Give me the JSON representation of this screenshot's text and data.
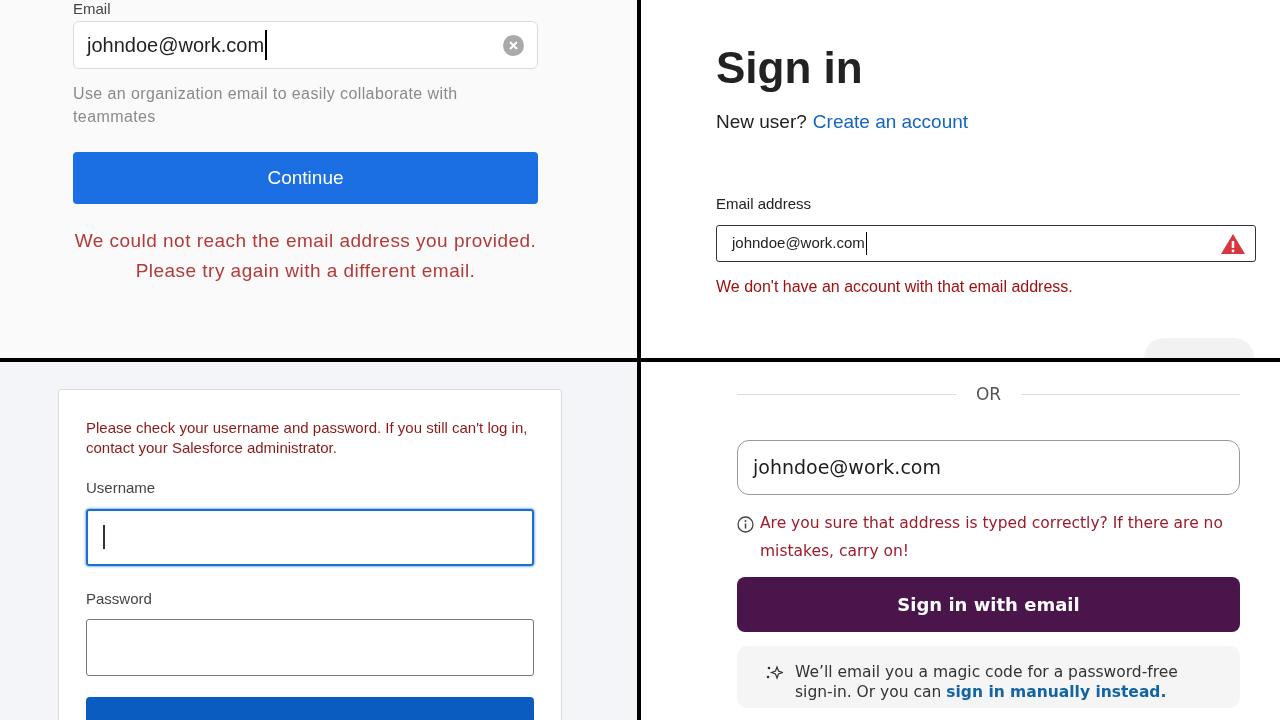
{
  "panels": [
    {
      "kind": "org_email",
      "label": "Email",
      "value": "johndoe@work.com",
      "hint": "Use an organization email to easily collaborate with teammates",
      "button": "Continue",
      "error": "We could not reach the email address you provided. Please try again with a different email."
    },
    {
      "kind": "sign_in",
      "title": "Sign in",
      "prompt": "New user?",
      "link": "Create an account",
      "label": "Email address",
      "value": "johndoe@work.com",
      "invalid": true,
      "error": "We don't have an account with that email address."
    },
    {
      "kind": "login",
      "error": "Please check your username and password. If you still can't log in, contact your Salesforce administrator.",
      "fields": [
        {
          "label": "Username",
          "focused": true
        },
        {
          "label": "Password",
          "focused": false
        }
      ]
    },
    {
      "kind": "magic",
      "divider": "OR",
      "value": "johndoe@work.com",
      "warning": "Are you sure that address is typed correctly? If there are no mistakes, carry on!",
      "button": "Sign in with email",
      "note": "We’ll email you a magic code for a password-free sign-in. Or you can",
      "note_link": "sign in manually instead."
    }
  ]
}
